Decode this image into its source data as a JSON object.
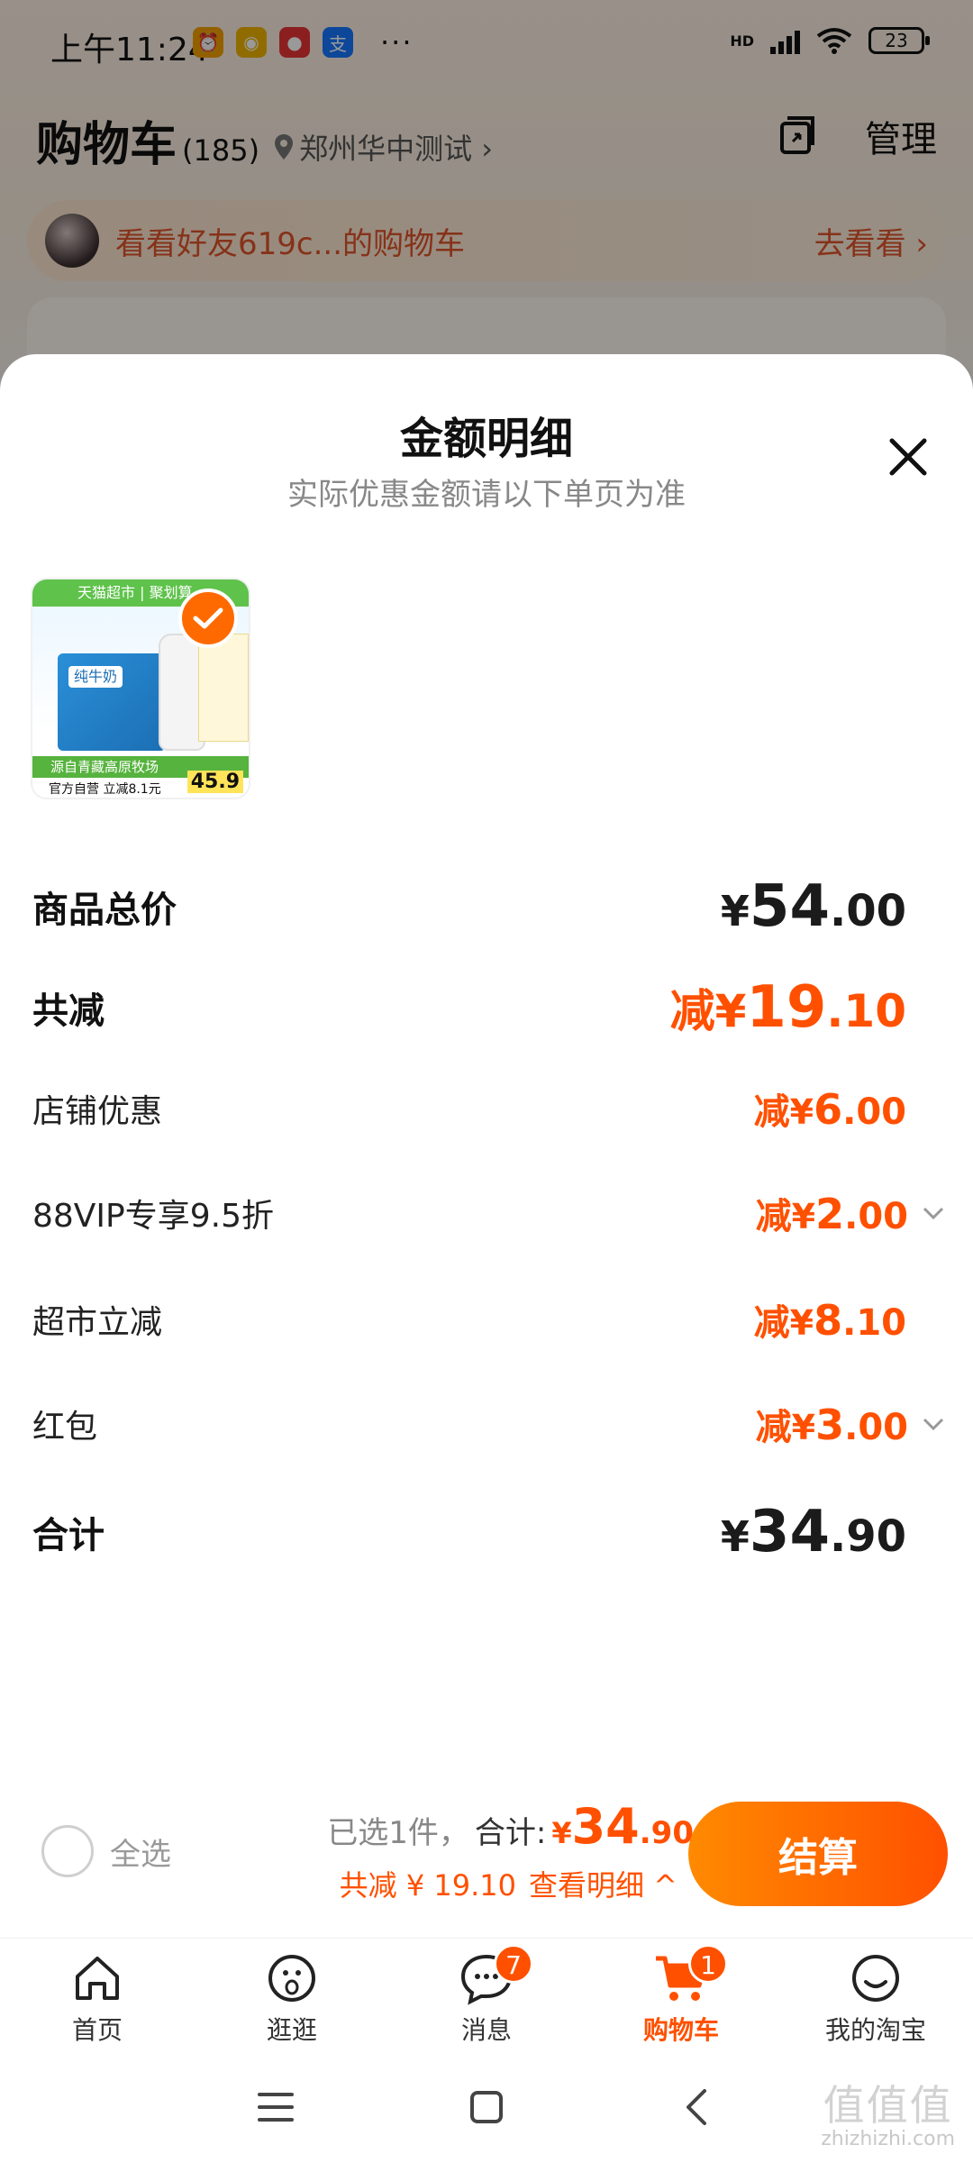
{
  "status_bar": {
    "time": "上午11:24",
    "battery": "23",
    "dots": "···",
    "network": "HD"
  },
  "cart": {
    "title": "购物车",
    "count": "(185)",
    "location": "郑州华中测试 ›",
    "manage_label": "管理",
    "friend_text": "看看好友619c...的购物车",
    "friend_go": "去看看 ›"
  },
  "sheet": {
    "title": "金额明细",
    "subtitle": "实际优惠金额请以下单页为准",
    "product": {
      "image_texts": {
        "store": "天猫超市 | 聚划算",
        "brand": "纯牛奶",
        "green_text": "源自青藏高原牧场",
        "strip_text": "官方自营 立减8.1元",
        "price": "45.9"
      }
    },
    "rows": [
      {
        "label": "商品总价",
        "prefix": "",
        "yen": "¥",
        "int": "54",
        "dec": ".00",
        "style": "bold-dark"
      },
      {
        "label": "共减",
        "prefix": "减",
        "yen": "¥",
        "int": "19",
        "dec": ".10",
        "style": "bold-orange"
      },
      {
        "label": "店铺优惠",
        "prefix": "减",
        "yen": "¥",
        "int": "6",
        "dec": ".00",
        "style": "small-orange"
      },
      {
        "label": "88VIP专享9.5折",
        "prefix": "减",
        "yen": "¥",
        "int": "2",
        "dec": ".00",
        "style": "small-orange-chevron"
      },
      {
        "label": "超市立减",
        "prefix": "减",
        "yen": "¥",
        "int": "8",
        "dec": ".10",
        "style": "small-orange"
      },
      {
        "label": "红包",
        "prefix": "减",
        "yen": "¥",
        "int": "3",
        "dec": ".00",
        "style": "small-orange-chevron"
      },
      {
        "label": "合计",
        "prefix": "",
        "yen": "¥",
        "int": "34",
        "dec": ".90",
        "style": "bold-dark"
      }
    ]
  },
  "checkout": {
    "select_all": "全选",
    "selected_text": "已选1件，",
    "total_label": "合计:",
    "total_yen": "¥",
    "total_int": "34",
    "total_dec": ".90",
    "discount_text": "共减 ¥ 19.10",
    "detail_link": "查看明细 ^",
    "pay_label": "结算"
  },
  "tabs": [
    {
      "label": "首页",
      "icon": "home-icon",
      "badge": ""
    },
    {
      "label": "逛逛",
      "icon": "browse-icon",
      "badge": ""
    },
    {
      "label": "消息",
      "icon": "message-icon",
      "badge": "7"
    },
    {
      "label": "购物车",
      "icon": "cart-icon",
      "badge": "1",
      "active": true
    },
    {
      "label": "我的淘宝",
      "icon": "profile-icon",
      "badge": ""
    }
  ],
  "watermark": {
    "big": "值值值",
    "small": "zhizhizhi.com"
  },
  "colors": {
    "accent": "#ff5000",
    "accent_light": "#ff8a00",
    "dark_text": "#1b1b1b",
    "muted_text": "#888888"
  }
}
